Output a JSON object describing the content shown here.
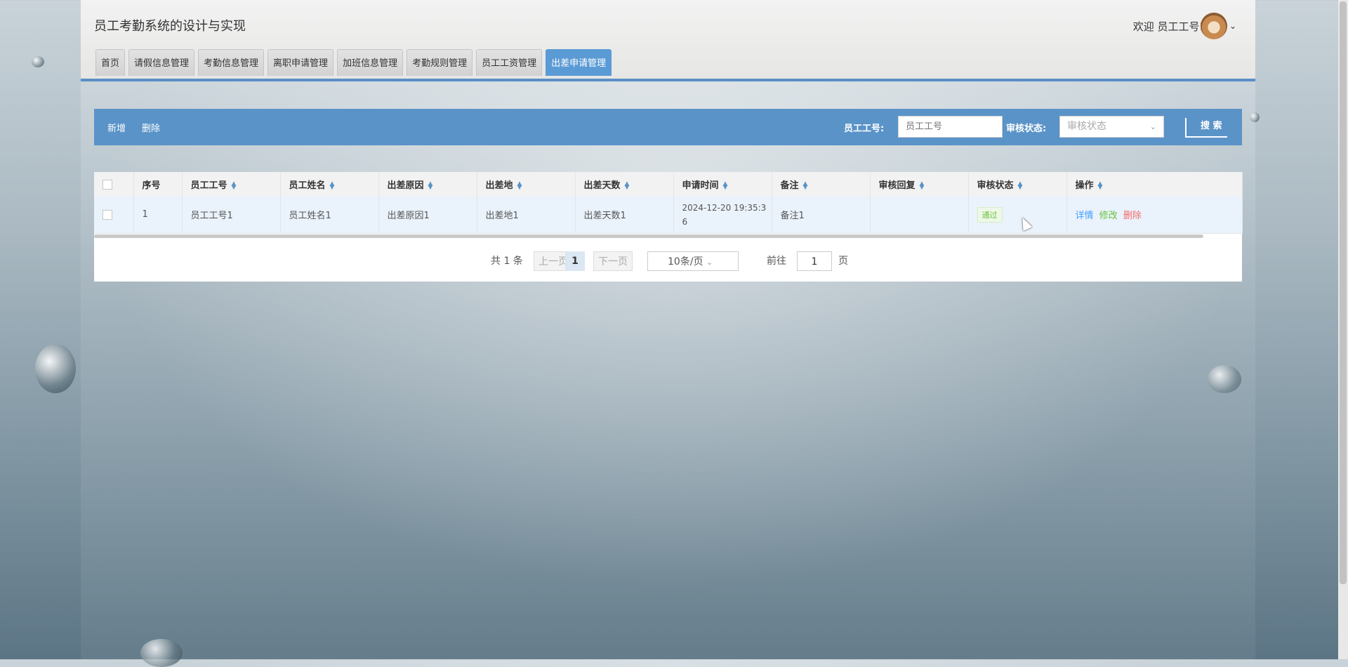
{
  "app": {
    "title": "员工考勤系统的设计与实现",
    "welcome": "欢迎 员工工号1"
  },
  "tabs": [
    "首页",
    "请假信息管理",
    "考勤信息管理",
    "离职申请管理",
    "加班信息管理",
    "考勤规则管理",
    "员工工资管理",
    "出差申请管理"
  ],
  "active_tab": "出差申请管理",
  "toolbar": {
    "add_label": "新增",
    "delete_label": "删除",
    "emp_label": "员工工号:",
    "emp_placeholder": "员工工号",
    "status_label": "审核状态:",
    "status_placeholder": "审核状态",
    "search_label": "搜 索"
  },
  "table": {
    "headers": [
      "序号",
      "员工工号",
      "员工姓名",
      "出差原因",
      "出差地",
      "出差天数",
      "申请时间",
      "备注",
      "审核回复",
      "审核状态",
      "操作"
    ],
    "rows": [
      {
        "index": "1",
        "emp_id": "员工工号1",
        "emp_name": "员工姓名1",
        "reason": "出差原因1",
        "place": "出差地1",
        "days": "出差天数1",
        "time_line1": "2024-12-20 19:35:3",
        "time_line2": "6",
        "note": "备注1",
        "reply": "",
        "status": "通过",
        "ops": {
          "detail": "详情",
          "edit": "修改",
          "delete": "删除"
        }
      }
    ]
  },
  "pager": {
    "total": "共 1 条",
    "prev": "上一页",
    "current": "1",
    "next": "下一页",
    "size": "10条/页",
    "goto_label": "前往",
    "goto_value": "1",
    "page_suffix": "页"
  },
  "colors": {
    "accent": "#5a93c8",
    "active_tab": "#5b9bd5",
    "detail": "#409eff",
    "edit": "#67c23a",
    "delete": "#f56c6c",
    "status": "#67c23a"
  }
}
